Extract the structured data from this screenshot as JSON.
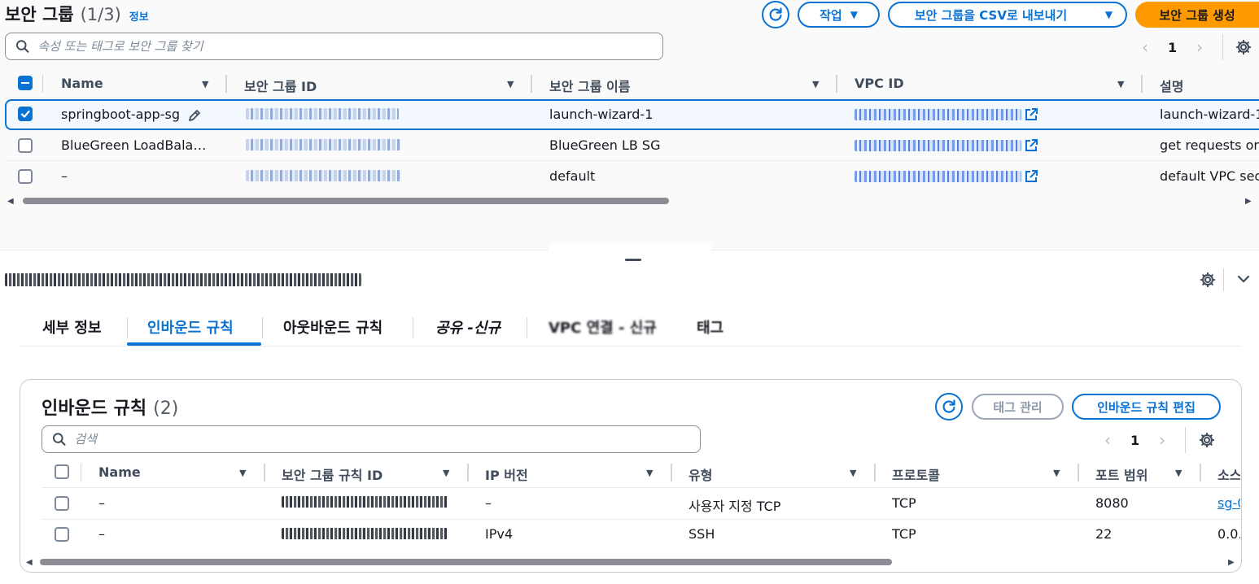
{
  "header": {
    "title": "보안 그룹",
    "count": "(1/3)",
    "info": "정보",
    "actions_label": "작업",
    "export_label": "보안 그룹을 CSV로 내보내기",
    "create_label": "보안 그룹 생성"
  },
  "search": {
    "placeholder": "속성 또는 태그로 보안 그룹 찾기"
  },
  "pagination": {
    "page": "1"
  },
  "table": {
    "columns": [
      "Name",
      "보안 그룹 ID",
      "보안 그룹 이름",
      "VPC ID",
      "설명"
    ],
    "rows": [
      {
        "name": "springboot-app-sg",
        "group_name": "launch-wizard-1",
        "description": "launch-wizard-1",
        "selected": true
      },
      {
        "name": "BlueGreen LoadBala…",
        "group_name": "BlueGreen LB SG",
        "description": "get requests on"
      },
      {
        "name": "–",
        "group_name": "default",
        "description": "default VPC sec"
      }
    ]
  },
  "detail": {
    "tabs": [
      "세부 정보",
      "인바운드 규칙",
      "아웃바운드 규칙",
      "공유 -신규",
      "VPC 연결 - 신규",
      "태그"
    ],
    "active_tab": "인바운드 규칙"
  },
  "inbound": {
    "title": "인바운드 규칙",
    "count": "(2)",
    "manage_tags": "태그 관리",
    "edit_rules": "인바운드 규칙 편집",
    "search_placeholder": "검색",
    "page": "1",
    "columns": [
      "Name",
      "보안 그룹 규칙 ID",
      "IP 버전",
      "유형",
      "프로토콜",
      "포트 범위",
      "소스"
    ],
    "rows": [
      {
        "name": "–",
        "ip_version": "–",
        "type": "사용자 지정 TCP",
        "protocol": "TCP",
        "port": "8080",
        "source": "sg-0"
      },
      {
        "name": "–",
        "ip_version": "IPv4",
        "type": "SSH",
        "protocol": "TCP",
        "port": "22",
        "source": "0.0."
      }
    ]
  },
  "colors": {
    "primary": "#0972d3",
    "accent": "#ff9900",
    "text": "#16191f"
  },
  "icons": [
    "search-icon",
    "refresh-icon",
    "caret-down-icon",
    "settings-icon",
    "external-link-icon",
    "edit-icon",
    "chevron-left-icon",
    "chevron-right-icon",
    "chevron-down-icon"
  ]
}
